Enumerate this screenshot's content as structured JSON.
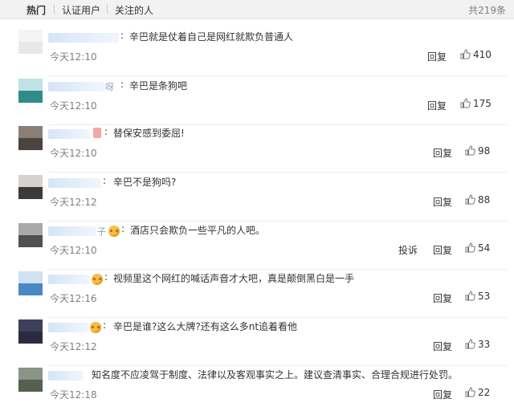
{
  "tabs": {
    "hot": "热门",
    "verified": "认证用户",
    "following": "关注的人",
    "total": "共219条"
  },
  "comments": [
    {
      "nick_tail": "",
      "text": "辛巴就是仗着自己是网红就欺负普通人",
      "time": "今天12:10",
      "report": "",
      "reply": "回复",
      "likes": "410"
    },
    {
      "nick_tail": "呀",
      "text": "辛巴是条狗吧",
      "time": "今天12:10",
      "report": "",
      "reply": "回复",
      "likes": "175"
    },
    {
      "nick_tail": "",
      "text": "替保安感到委屈!",
      "time": "今天12:10",
      "report": "",
      "reply": "回复",
      "likes": "98"
    },
    {
      "nick_tail": "",
      "text": "辛巴不是狗吗?",
      "time": "今天12:12",
      "report": "",
      "reply": "回复",
      "likes": "88"
    },
    {
      "nick_tail": "子",
      "text": "酒店只会欺负一些平凡的人吧。",
      "time": "今天12:10",
      "report": "投诉",
      "reply": "回复",
      "likes": "54"
    },
    {
      "nick_tail": "",
      "text": "视频里这个网红的喊话声音才大吧，真是颠倒黑白是一手",
      "time": "今天12:16",
      "report": "",
      "reply": "回复",
      "likes": "53"
    },
    {
      "nick_tail": "",
      "text": "辛巴是谁?这么大牌?还有这么多nt追着看他",
      "time": "今天12:12",
      "report": "",
      "reply": "回复",
      "likes": "33"
    },
    {
      "nick_tail": "",
      "text": "知名度不应凌驾于制度、法律以及客观事实之上。建议查清事实、合理合规进行处罚。",
      "time": "今天12:18",
      "report": "",
      "reply": "回复",
      "likes": "22"
    }
  ]
}
